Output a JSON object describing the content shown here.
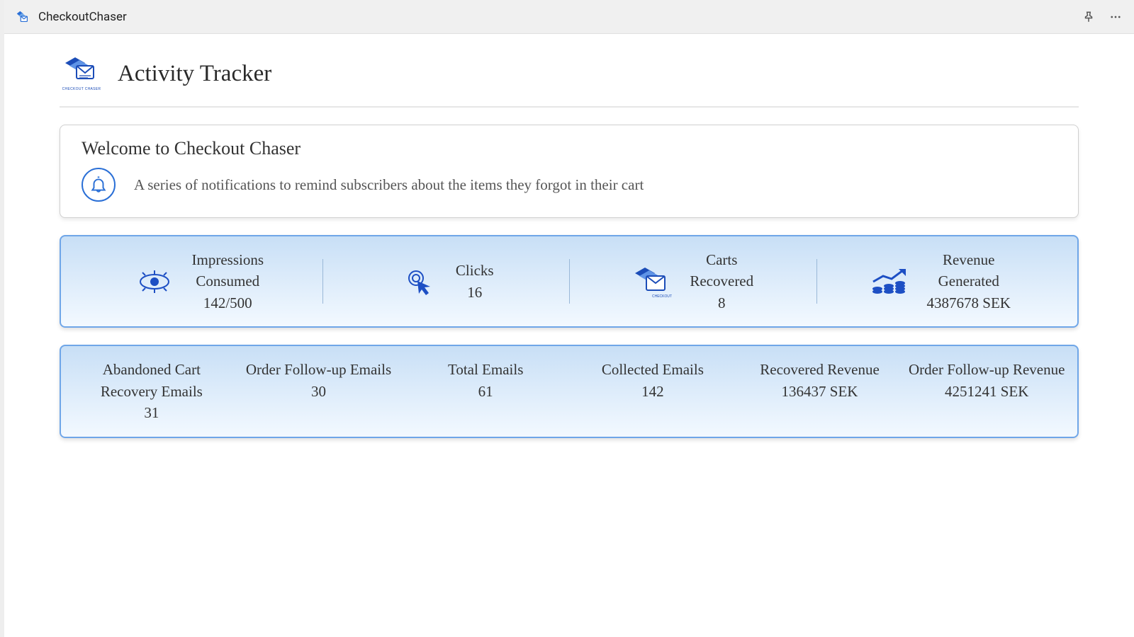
{
  "titlebar": {
    "app_name": "CheckoutChaser"
  },
  "header": {
    "logo_caption": "CHECKOUT CHASER",
    "page_title": "Activity Tracker"
  },
  "welcome": {
    "title": "Welcome to Checkout Chaser",
    "description": "A series of notifications to remind subscribers about the items they forgot in their cart"
  },
  "metrics": {
    "impressions": {
      "label_line1": "Impressions",
      "label_line2": "Consumed",
      "value": "142/500"
    },
    "clicks": {
      "label": "Clicks",
      "value": "16"
    },
    "carts": {
      "label_line1": "Carts",
      "label_line2": "Recovered",
      "value": "8"
    },
    "revenue": {
      "label_line1": "Revenue",
      "label_line2": "Generated",
      "value": "4387678 SEK"
    }
  },
  "emails": {
    "abandoned": {
      "label": "Abandoned Cart Recovery Emails",
      "value": "31"
    },
    "followup": {
      "label": "Order Follow-up Emails",
      "value": "30"
    },
    "total": {
      "label": "Total Emails",
      "value": "61"
    },
    "collected": {
      "label": "Collected Emails",
      "value": "142"
    },
    "recovered": {
      "label": "Recovered Revenue",
      "value": "136437 SEK"
    },
    "fu_revenue": {
      "label": "Order Follow-up Revenue",
      "value": "4251241 SEK"
    }
  }
}
